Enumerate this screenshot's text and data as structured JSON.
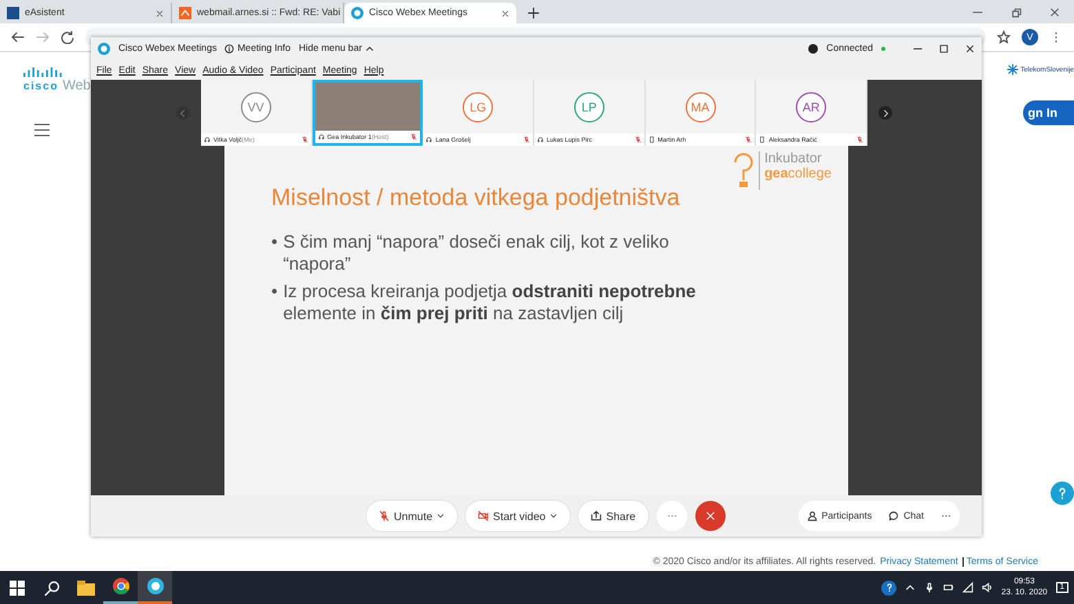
{
  "browser": {
    "tabs": [
      {
        "label": "eAsistent",
        "selected": false,
        "kind": "easistent"
      },
      {
        "label": "webmail.arnes.si :: Fwd: RE: Vabi",
        "selected": false,
        "kind": "mail"
      },
      {
        "label": "Cisco Webex Meetings",
        "selected": true,
        "kind": "webex"
      }
    ],
    "profile_initial": "V"
  },
  "page": {
    "logo_text": "cisco",
    "product_text": "Web",
    "partner_logo": "TelekomSlovenije",
    "sign_in_button": "gn In",
    "footer": {
      "copyright": "© 2020 Cisco and/or its affiliates. All rights reserved.",
      "links": [
        "Privacy Statement",
        "Terms of Service"
      ]
    }
  },
  "webex_window": {
    "title": "Cisco Webex Meetings",
    "meeting_info": "Meeting Info",
    "hide_menu": "Hide menu bar",
    "status": "Connected",
    "menu": [
      "File",
      "Edit",
      "Share",
      "View",
      "Audio & Video",
      "Participant",
      "Meeting",
      "Help"
    ],
    "participants": [
      {
        "initials": "VV",
        "name": "Vitka Voljč",
        "role": "(Me)",
        "color": "#8a8a8a",
        "kind": "computer",
        "selected": false
      },
      {
        "name": "Gea Inkubator 1",
        "role": "(Host)",
        "kind": "computer",
        "selected": true
      },
      {
        "initials": "LG",
        "name": "Lana Grošelj",
        "color": "#f0703a",
        "kind": "computer",
        "selected": false
      },
      {
        "initials": "LP",
        "name": "Lukas Lupis Pirc",
        "color": "#2aa876",
        "kind": "computer",
        "selected": false
      },
      {
        "initials": "MA",
        "name": "Martin Arh",
        "color": "#f0703a",
        "kind": "phone",
        "selected": false
      },
      {
        "initials": "AR",
        "name": "Aleksandra Račić",
        "color": "#a04bb0",
        "kind": "phone",
        "selected": false
      }
    ],
    "slide": {
      "title": "Miselnost / metoda vitkega podjetništva",
      "brand_top": "Inkubator",
      "brand_bold": "gea",
      "brand_rest": "college",
      "bullets": [
        {
          "marker": "•",
          "text": "S čim manj “napora” doseči enak cilj, kot z veliko “napora”"
        },
        {
          "marker": "•",
          "text": "Iz procesa kreiranja podjetja **odstraniti nepotrebne** elemente in **čim prej priti** na zastavljen cilj"
        }
      ]
    },
    "controls": {
      "unmute": "Unmute",
      "start_video": "Start video",
      "share": "Share",
      "participants": "Participants",
      "chat": "Chat"
    }
  },
  "taskbar": {
    "time": "09:53",
    "date": "23. 10. 2020",
    "notifications": "1"
  }
}
